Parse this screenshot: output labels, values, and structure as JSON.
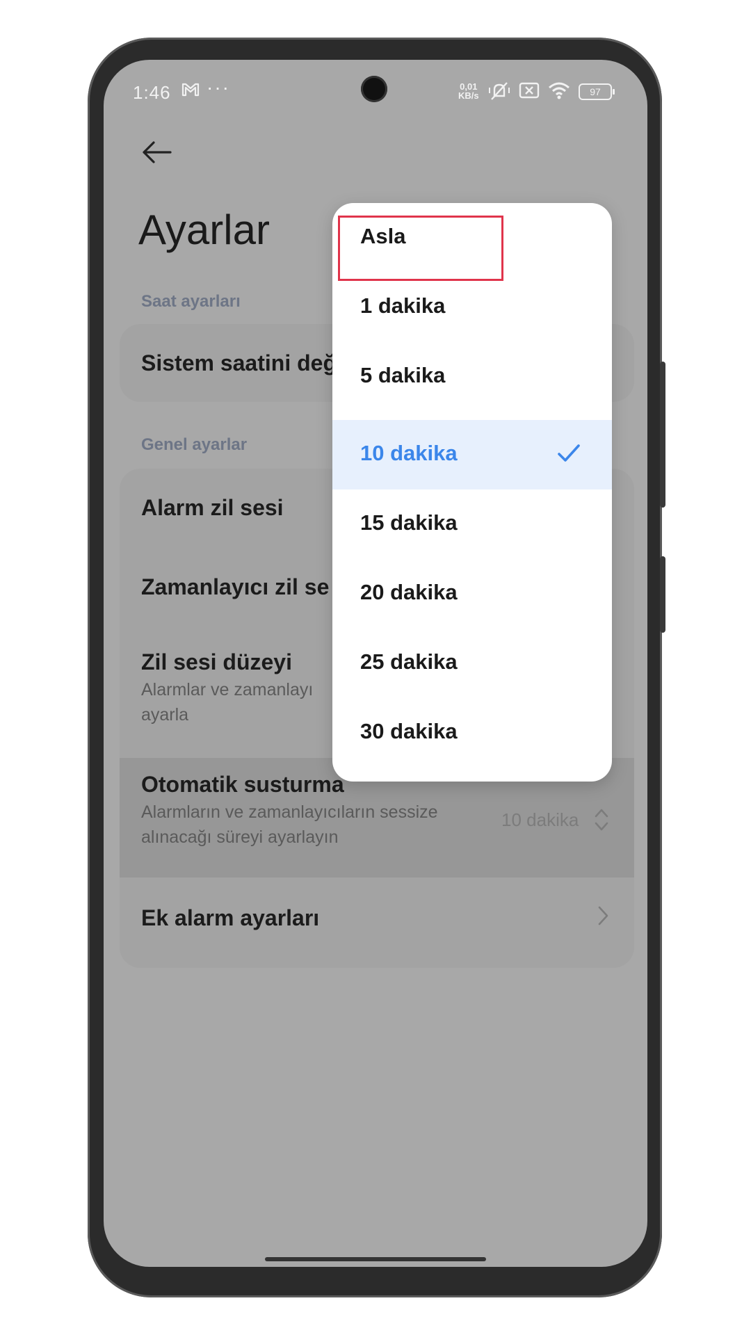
{
  "status_bar": {
    "time": "1:46",
    "speed_value": "0,01",
    "speed_unit": "KB/s",
    "battery": "97"
  },
  "page": {
    "title": "Ayarlar",
    "back_icon": "back-arrow-icon"
  },
  "sections": {
    "clock": {
      "label": "Saat ayarları",
      "items": [
        {
          "title": "Sistem saatini değ"
        }
      ]
    },
    "general": {
      "label": "Genel ayarlar",
      "items": [
        {
          "title": "Alarm zil sesi"
        },
        {
          "title": "Zamanlayıcı zil se"
        },
        {
          "title": "Zil sesi düzeyi",
          "subtitle_line1": "Alarmlar ve zamanlayı",
          "subtitle_line2": "ayarla"
        },
        {
          "title": "Otomatik susturma",
          "subtitle_line1": "Alarmların ve zamanlayıcıların sessize",
          "subtitle_line2": "alınacağı süreyi ayarlayın",
          "value": "10 dakika"
        },
        {
          "title": "Ek alarm ayarları"
        }
      ]
    }
  },
  "popup": {
    "options": [
      {
        "label": "Asla"
      },
      {
        "label": "1 dakika"
      },
      {
        "label": "5 dakika"
      },
      {
        "label": "10 dakika",
        "selected": true
      },
      {
        "label": "15 dakika"
      },
      {
        "label": "20 dakika"
      },
      {
        "label": "25 dakika"
      },
      {
        "label": "30 dakika"
      }
    ],
    "selected_index": 3,
    "highlighted_index": 0
  },
  "colors": {
    "accent": "#3b86ea",
    "highlight_box": "#e0344b",
    "scrim": "#a8a8a8"
  }
}
